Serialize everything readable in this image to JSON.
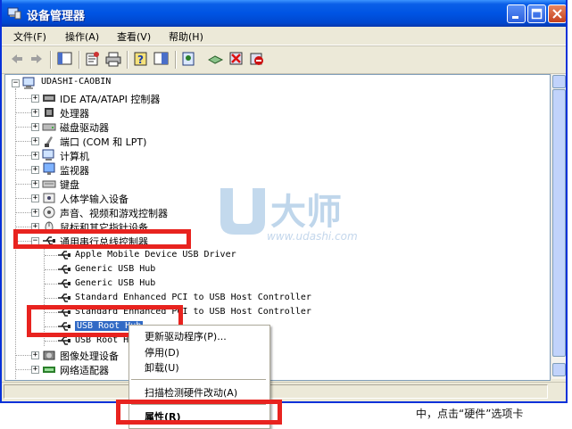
{
  "window": {
    "title": "设备管理器"
  },
  "menu": [
    {
      "label": "文件(F)"
    },
    {
      "label": "操作(A)"
    },
    {
      "label": "查看(V)"
    },
    {
      "label": "帮助(H)"
    }
  ],
  "toolbar_icons": [
    "back-icon",
    "forward-icon",
    "show-hide-console-tree-icon",
    "properties-icon",
    "print-icon",
    "help-icon",
    "export-icon",
    "scan-hardware-icon",
    "update-driver-icon",
    "uninstall-icon",
    "disable-icon"
  ],
  "tree": {
    "root": "UDASHI-CAOBIN",
    "categories": [
      {
        "label": "IDE ATA/ATAPI 控制器",
        "icon": "ide-icon"
      },
      {
        "label": "处理器",
        "icon": "cpu-icon"
      },
      {
        "label": "磁盘驱动器",
        "icon": "disk-drive-icon"
      },
      {
        "label": "端口 (COM 和 LPT)",
        "icon": "port-icon"
      },
      {
        "label": "计算机",
        "icon": "computer-icon"
      },
      {
        "label": "监视器",
        "icon": "monitor-icon"
      },
      {
        "label": "键盘",
        "icon": "keyboard-icon"
      },
      {
        "label": "人体学输入设备",
        "icon": "hid-icon"
      },
      {
        "label": "声音、视频和游戏控制器",
        "icon": "sound-icon"
      },
      {
        "label": "鼠标和其它指针设备",
        "icon": "mouse-icon"
      },
      {
        "label": "通用串行总线控制器",
        "icon": "usb-icon"
      }
    ],
    "usb_children": [
      "Apple Mobile Device USB Driver",
      "Generic USB Hub",
      "Generic USB Hub",
      "Standard Enhanced PCI to USB Host Controller",
      "Standard Enhanced PCI to USB Host Controller",
      "USB Root Hub",
      "USB Root Hub"
    ],
    "after": [
      {
        "label": "图像处理设备",
        "icon": "imaging-icon"
      },
      {
        "label": "网络适配器",
        "icon": "network-icon"
      }
    ]
  },
  "context_menu": {
    "items": [
      {
        "label": "更新驱动程序(P)..."
      },
      {
        "label": "停用(D)"
      },
      {
        "label": "卸载(U)"
      },
      {
        "label": "扫描检测硬件改动(A)"
      },
      {
        "label": "属性(R)"
      }
    ]
  },
  "watermark": {
    "brand": "大师",
    "url": "www.udashi.com"
  },
  "background_text": "中，点击“硬件”选项卡"
}
